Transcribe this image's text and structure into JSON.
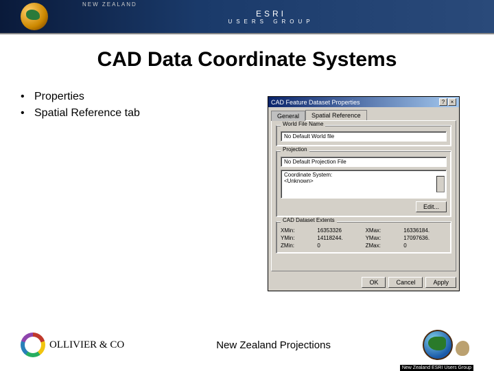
{
  "banner": {
    "nz": "NEW ZEALAND",
    "main": "ESRI",
    "sub": "USERS GROUP"
  },
  "title": "CAD Data Coordinate Systems",
  "bullets": [
    "Properties",
    "Spatial Reference tab"
  ],
  "dialog": {
    "title": "CAD Feature Dataset Properties",
    "tabs": {
      "general": "General",
      "spatial": "Spatial Reference"
    },
    "group1": {
      "title": "World File Name",
      "value": "No Default World file"
    },
    "group2": {
      "title": "Projection",
      "value": "No Default Projection File",
      "coord_label": "Coordinate System:",
      "coord_value": "<Unknown>",
      "edit": "Edit..."
    },
    "group3": {
      "title": "CAD Dataset Extents",
      "rows": [
        {
          "l1": "XMin:",
          "v1": "16353326",
          "l2": "XMax:",
          "v2": "16336184."
        },
        {
          "l1": "YMin:",
          "v1": "14118244.",
          "l2": "YMax:",
          "v2": "17097636."
        },
        {
          "l1": "ZMin:",
          "v1": "0",
          "l2": "ZMax:",
          "v2": "0"
        }
      ]
    },
    "buttons": {
      "ok": "OK",
      "cancel": "Cancel",
      "apply": "Apply"
    }
  },
  "footer": {
    "ollivier": "OLLIVIER & CO",
    "center": "New Zealand Projections",
    "right_caption": "New Zealand ESRI Users Group"
  }
}
